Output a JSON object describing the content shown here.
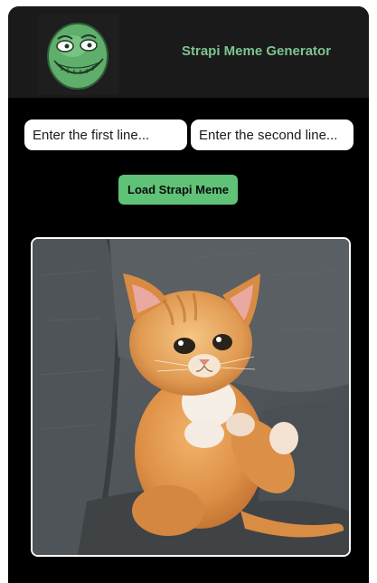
{
  "header": {
    "title": "Strapi Meme Generator",
    "logo_icon": "troll-face-logo"
  },
  "form": {
    "first_line_placeholder": "Enter the first line...",
    "first_line_value": "",
    "second_line_placeholder": "Enter the second line...",
    "second_line_value": "",
    "load_button_label": "Load Strapi Meme"
  },
  "meme": {
    "image_subject": "orange-kitten-on-gray-couch",
    "top_text": "",
    "bottom_text": ""
  },
  "colors": {
    "accent": "#5fc277",
    "title": "#7ec48f",
    "header_bg": "#1a1a1a",
    "page_bg": "#000000"
  }
}
